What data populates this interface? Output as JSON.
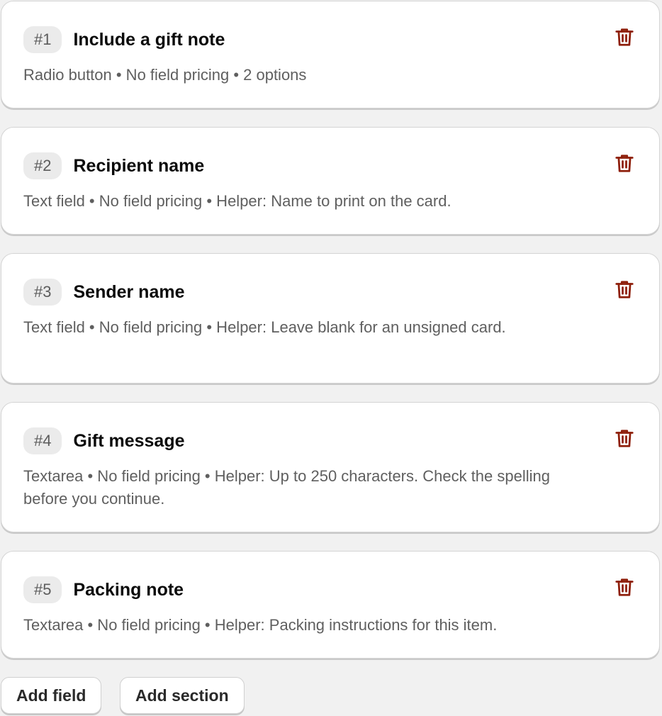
{
  "accent_danger": "#8e1f0b",
  "fields": [
    {
      "number": "#1",
      "title": "Include a gift note",
      "meta": "Radio button • No field pricing • 2 options",
      "delete_icon": "trash-icon"
    },
    {
      "number": "#2",
      "title": "Recipient name",
      "meta": "Text field • No field pricing • Helper: Name to print on the card.",
      "delete_icon": "trash-icon"
    },
    {
      "number": "#3",
      "title": "Sender name",
      "meta": "Text field • No field pricing • Helper: Leave blank for an unsigned card.",
      "delete_icon": "trash-icon"
    },
    {
      "number": "#4",
      "title": "Gift message",
      "meta": "Textarea • No field pricing • Helper: Up to 250 characters. Check the spelling before you continue.",
      "delete_icon": "trash-icon"
    },
    {
      "number": "#5",
      "title": "Packing note",
      "meta": "Textarea • No field pricing • Helper: Packing instructions for this item.",
      "delete_icon": "trash-icon"
    }
  ],
  "actions": {
    "add_field_label": "Add field",
    "add_section_label": "Add section"
  }
}
